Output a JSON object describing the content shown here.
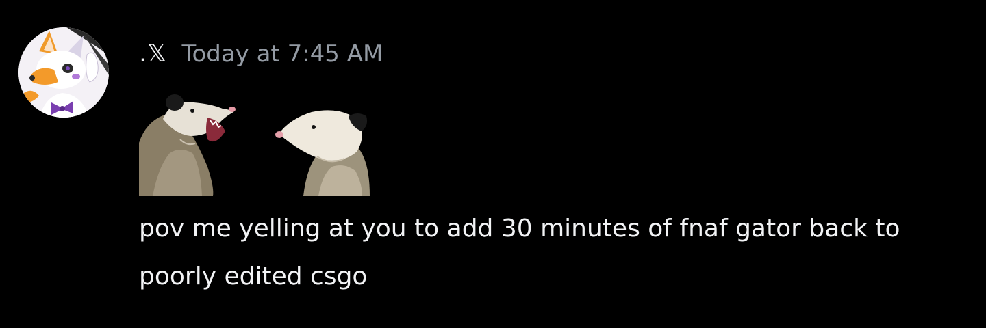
{
  "message": {
    "author": ".𝕏",
    "timestamp": "Today at 7:45 AM",
    "content": "pov me yelling at you to add 30 minutes of fnaf gator back to poorly edited csgo",
    "avatar_icon": "fox-character-avatar",
    "attachment_icon": "two-opossums-image"
  },
  "colors": {
    "background": "#000000",
    "text": "#f2f3f5",
    "muted": "#949ba4"
  }
}
